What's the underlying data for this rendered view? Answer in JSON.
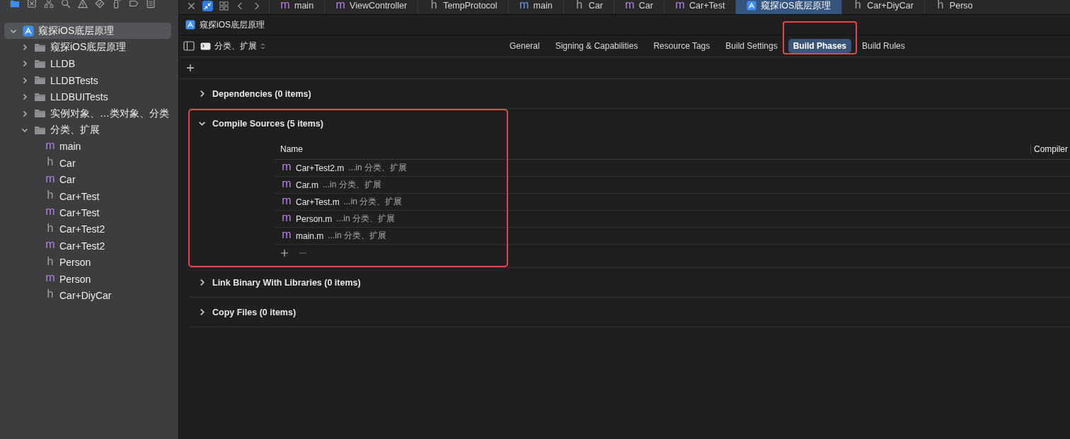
{
  "navigator_tabs": [
    {
      "kind": "folder",
      "selected": true
    },
    {
      "kind": "source-control",
      "selected": false
    },
    {
      "kind": "hierarchy",
      "selected": false
    },
    {
      "kind": "search",
      "selected": false
    },
    {
      "kind": "warning",
      "selected": false
    },
    {
      "kind": "test",
      "selected": false
    },
    {
      "kind": "debug",
      "selected": false
    },
    {
      "kind": "breakpoint",
      "selected": false
    },
    {
      "kind": "report",
      "selected": false
    }
  ],
  "project_tree": [
    {
      "label": "窥探iOS底层原理",
      "kind": "project",
      "expanded": true,
      "selected": true,
      "children": [
        {
          "label": "窥探iOS底层原理",
          "kind": "folder",
          "expanded": false,
          "selected": false
        },
        {
          "label": "LLDB",
          "kind": "folder",
          "expanded": false,
          "selected": false
        },
        {
          "label": "LLDBTests",
          "kind": "folder",
          "expanded": false,
          "selected": false
        },
        {
          "label": "LLDBUITests",
          "kind": "folder",
          "expanded": false,
          "selected": false
        },
        {
          "label": "实例对象、…类对象、分类",
          "kind": "folder",
          "expanded": false,
          "selected": false
        },
        {
          "label": "分类、扩展",
          "kind": "folder",
          "expanded": true,
          "selected": false,
          "children": [
            {
              "label": "main",
              "kind": "source",
              "icon": "m",
              "selected": false
            },
            {
              "label": "Car",
              "kind": "header",
              "icon": "h",
              "selected": false
            },
            {
              "label": "Car",
              "kind": "source",
              "icon": "m",
              "selected": false
            },
            {
              "label": "Car+Test",
              "kind": "header",
              "icon": "h",
              "selected": false
            },
            {
              "label": "Car+Test",
              "kind": "source",
              "icon": "m",
              "selected": false
            },
            {
              "label": "Car+Test2",
              "kind": "header",
              "icon": "h",
              "selected": false
            },
            {
              "label": "Car+Test2",
              "kind": "source",
              "icon": "m",
              "selected": false
            },
            {
              "label": "Person",
              "kind": "header",
              "icon": "h",
              "selected": false
            },
            {
              "label": "Person",
              "kind": "source",
              "icon": "m",
              "selected": false
            },
            {
              "label": "Car+DiyCar",
              "kind": "header",
              "icon": "h",
              "selected": false
            }
          ]
        }
      ]
    }
  ],
  "editor_controls": [
    {
      "kind": "close",
      "selected": false
    },
    {
      "kind": "related",
      "selected": true
    },
    {
      "kind": "grid",
      "selected": false
    },
    {
      "kind": "back",
      "selected": false
    },
    {
      "kind": "forward",
      "selected": false
    }
  ],
  "editor_tabs": [
    {
      "label": "main",
      "kind": "source",
      "icon": "m",
      "selected": false
    },
    {
      "label": "ViewController",
      "kind": "source",
      "icon": "m",
      "selected": false
    },
    {
      "label": "TempProtocol",
      "kind": "header",
      "icon": "h",
      "selected": false
    },
    {
      "label": "main",
      "kind": "source-plus",
      "icon": "m",
      "selected": false
    },
    {
      "label": "Car",
      "kind": "header",
      "icon": "h",
      "selected": false
    },
    {
      "label": "Car",
      "kind": "source",
      "icon": "m",
      "selected": false
    },
    {
      "label": "Car+Test",
      "kind": "source",
      "icon": "m",
      "selected": false
    },
    {
      "label": "窥探iOS底层原理",
      "kind": "project",
      "selected": true
    },
    {
      "label": "Car+DiyCar",
      "kind": "header",
      "icon": "h",
      "selected": false
    },
    {
      "label": "Perso",
      "kind": "header",
      "icon": "h",
      "selected": false
    }
  ],
  "breadcrumb": {
    "label": "窥探iOS底层原理"
  },
  "target_selector": {
    "label": "分类、扩展"
  },
  "settings_tabs": [
    {
      "label": "General",
      "selected": false,
      "highlighted": false
    },
    {
      "label": "Signing & Capabilities",
      "selected": false,
      "highlighted": false
    },
    {
      "label": "Resource Tags",
      "selected": false,
      "highlighted": false
    },
    {
      "label": "Build Settings",
      "selected": false,
      "highlighted": false
    },
    {
      "label": "Build Phases",
      "selected": true,
      "highlighted": true
    },
    {
      "label": "Build Rules",
      "selected": false,
      "highlighted": false
    }
  ],
  "build_phases": [
    {
      "title": "Dependencies (0 items)",
      "expanded": false,
      "highlighted": false
    },
    {
      "title": "Compile Sources (5 items)",
      "expanded": true,
      "highlighted": true,
      "table": {
        "columns": [
          "Name",
          "Compiler"
        ],
        "rows": [
          {
            "kind": "source",
            "icon": "m",
            "name": "Car+Test2.m",
            "location": "...in 分类、扩展"
          },
          {
            "kind": "source",
            "icon": "m",
            "name": "Car.m",
            "location": "...in 分类、扩展"
          },
          {
            "kind": "source",
            "icon": "m",
            "name": "Car+Test.m",
            "location": "...in 分类、扩展"
          },
          {
            "kind": "source",
            "icon": "m",
            "name": "Person.m",
            "location": "...in 分类、扩展"
          },
          {
            "kind": "source",
            "icon": "m",
            "name": "main.m",
            "location": "...in 分类、扩展"
          }
        ]
      }
    },
    {
      "title": "Link Binary With Libraries (0 items)",
      "expanded": false,
      "highlighted": false
    },
    {
      "title": "Copy Files (0 items)",
      "expanded": false,
      "highlighted": false
    }
  ]
}
